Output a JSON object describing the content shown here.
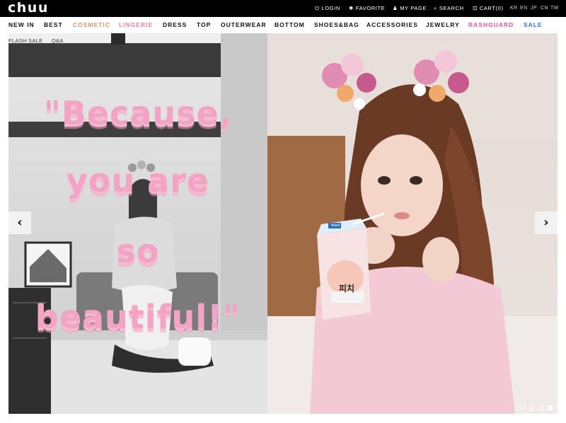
{
  "brand": {
    "logo": "chuu"
  },
  "utility_nav": [
    {
      "label": "LOGIN",
      "icon": "power-icon",
      "glyph": "⏻"
    },
    {
      "label": "FAVORITE",
      "icon": "gear-icon",
      "glyph": "✱"
    },
    {
      "label": "MY PAGE",
      "icon": "user-icon",
      "glyph": "♟"
    },
    {
      "label": "SEARCH",
      "icon": "search-icon",
      "glyph": "⌕"
    },
    {
      "label": "CART(0)",
      "icon": "cart-icon",
      "glyph": "⊡"
    }
  ],
  "languages": [
    "KR",
    "EN",
    "JP",
    "CN",
    "TW"
  ],
  "main_nav": [
    {
      "label": "NEW IN",
      "color": "#111111"
    },
    {
      "label": "BEST",
      "color": "#111111"
    },
    {
      "label": "COSMETIC",
      "color": "#c79a6e"
    },
    {
      "label": "LINGERIE",
      "color": "#e8809e"
    },
    {
      "label": "DRESS",
      "color": "#111111"
    },
    {
      "label": "TOP",
      "color": "#111111"
    },
    {
      "label": "OUTERWEAR",
      "color": "#111111"
    },
    {
      "label": "BOTTOM",
      "color": "#111111"
    },
    {
      "label": "SHOES&BAG",
      "color": "#111111"
    },
    {
      "label": "ACCESSORIES",
      "color": "#111111"
    },
    {
      "label": "JEWELRY",
      "color": "#111111"
    },
    {
      "label": "RASHGUARD",
      "color": "#e0579b"
    },
    {
      "label": "SALE",
      "color": "#3d6fd6"
    }
  ],
  "sub_tabs": [
    "FLASH SALE",
    "Q&A"
  ],
  "hero": {
    "quote_lines": [
      "\"Because,",
      "you are",
      "so",
      "beautiful!\""
    ],
    "carton_text": "피치",
    "brand_label": "Maeil",
    "prev_glyph": "‹",
    "next_glyph": "›",
    "slide_count": 4,
    "active_slide": 4
  },
  "colors": {
    "topbar": "#000000",
    "quote_pink": "#f3a3c3"
  }
}
